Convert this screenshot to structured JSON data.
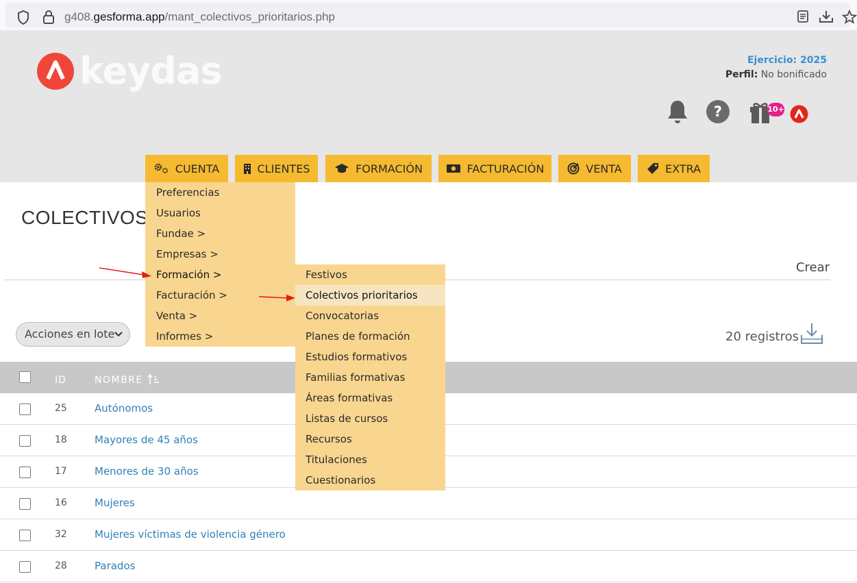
{
  "browser": {
    "url_prefix": "g408.",
    "url_domain": "gesforma.app",
    "url_path": "/mant_colectivos_prioritarios.php"
  },
  "header": {
    "logo_text": "keydas",
    "ejercicio": "Ejercicio: 2025",
    "perfil_label": "Perfil:",
    "perfil_value": "No bonificado",
    "gift_badge": "10+"
  },
  "menu": {
    "tabs": [
      {
        "label": "CUENTA",
        "icon": "gears-icon"
      },
      {
        "label": "CLIENTES",
        "icon": "building-icon"
      },
      {
        "label": "FORMACIÓN",
        "icon": "graduation-cap-icon"
      },
      {
        "label": "FACTURACIÓN",
        "icon": "money-bill-icon"
      },
      {
        "label": "VENTA",
        "icon": "target-icon"
      },
      {
        "label": "EXTRA",
        "icon": "tag-icon"
      }
    ],
    "cuenta_items": [
      "Preferencias",
      "Usuarios",
      "Fundae >",
      "Empresas >",
      "Formación >",
      "Facturación >",
      "Venta >",
      "Informes >"
    ],
    "formacion_items": [
      "Festivos",
      "Colectivos prioritarios",
      "Convocatorias",
      "Planes de formación",
      "Estudios formativos",
      "Familias formativas",
      "Áreas formativas",
      "Listas de cursos",
      "Recursos",
      "Titulaciones",
      "Cuestionarios"
    ]
  },
  "page": {
    "title": "COLECTIVOS P",
    "crear": "Crear",
    "lote_label": "Acciones en lote",
    "registros": "20 registros"
  },
  "table": {
    "col_id": "ID",
    "col_name": "NOMBRE",
    "rows": [
      {
        "id": "25",
        "name": "Autónomos"
      },
      {
        "id": "18",
        "name": "Mayores de 45 años"
      },
      {
        "id": "17",
        "name": "Menores de 30 años"
      },
      {
        "id": "16",
        "name": "Mujeres"
      },
      {
        "id": "32",
        "name": "Mujeres víctimas de violencia género"
      },
      {
        "id": "28",
        "name": "Parados"
      }
    ]
  },
  "colors": {
    "tab_bg": "#f5ba2f",
    "menu_bg": "#f9d68f",
    "link": "#2f80b8",
    "accent_red": "#e8442f"
  }
}
